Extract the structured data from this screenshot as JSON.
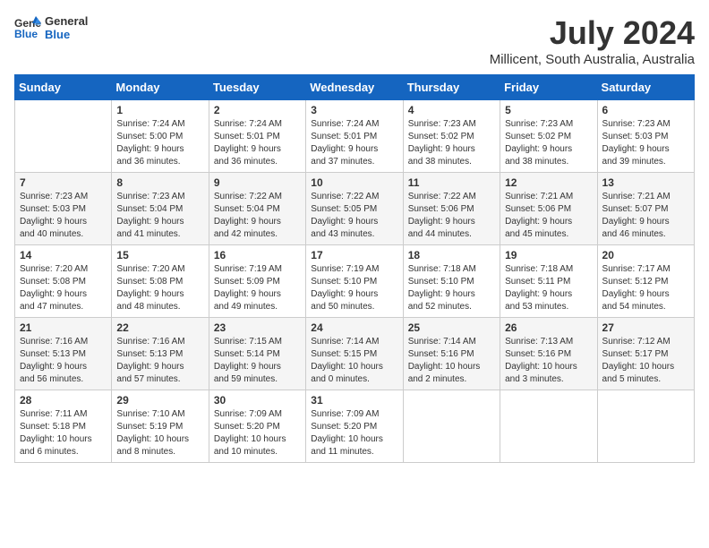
{
  "header": {
    "logo_line1": "General",
    "logo_line2": "Blue",
    "month_year": "July 2024",
    "location": "Millicent, South Australia, Australia"
  },
  "calendar": {
    "weekdays": [
      "Sunday",
      "Monday",
      "Tuesday",
      "Wednesday",
      "Thursday",
      "Friday",
      "Saturday"
    ],
    "weeks": [
      [
        {
          "day": "",
          "info": ""
        },
        {
          "day": "1",
          "info": "Sunrise: 7:24 AM\nSunset: 5:00 PM\nDaylight: 9 hours\nand 36 minutes."
        },
        {
          "day": "2",
          "info": "Sunrise: 7:24 AM\nSunset: 5:01 PM\nDaylight: 9 hours\nand 36 minutes."
        },
        {
          "day": "3",
          "info": "Sunrise: 7:24 AM\nSunset: 5:01 PM\nDaylight: 9 hours\nand 37 minutes."
        },
        {
          "day": "4",
          "info": "Sunrise: 7:23 AM\nSunset: 5:02 PM\nDaylight: 9 hours\nand 38 minutes."
        },
        {
          "day": "5",
          "info": "Sunrise: 7:23 AM\nSunset: 5:02 PM\nDaylight: 9 hours\nand 38 minutes."
        },
        {
          "day": "6",
          "info": "Sunrise: 7:23 AM\nSunset: 5:03 PM\nDaylight: 9 hours\nand 39 minutes."
        }
      ],
      [
        {
          "day": "7",
          "info": "Sunrise: 7:23 AM\nSunset: 5:03 PM\nDaylight: 9 hours\nand 40 minutes."
        },
        {
          "day": "8",
          "info": "Sunrise: 7:23 AM\nSunset: 5:04 PM\nDaylight: 9 hours\nand 41 minutes."
        },
        {
          "day": "9",
          "info": "Sunrise: 7:22 AM\nSunset: 5:04 PM\nDaylight: 9 hours\nand 42 minutes."
        },
        {
          "day": "10",
          "info": "Sunrise: 7:22 AM\nSunset: 5:05 PM\nDaylight: 9 hours\nand 43 minutes."
        },
        {
          "day": "11",
          "info": "Sunrise: 7:22 AM\nSunset: 5:06 PM\nDaylight: 9 hours\nand 44 minutes."
        },
        {
          "day": "12",
          "info": "Sunrise: 7:21 AM\nSunset: 5:06 PM\nDaylight: 9 hours\nand 45 minutes."
        },
        {
          "day": "13",
          "info": "Sunrise: 7:21 AM\nSunset: 5:07 PM\nDaylight: 9 hours\nand 46 minutes."
        }
      ],
      [
        {
          "day": "14",
          "info": "Sunrise: 7:20 AM\nSunset: 5:08 PM\nDaylight: 9 hours\nand 47 minutes."
        },
        {
          "day": "15",
          "info": "Sunrise: 7:20 AM\nSunset: 5:08 PM\nDaylight: 9 hours\nand 48 minutes."
        },
        {
          "day": "16",
          "info": "Sunrise: 7:19 AM\nSunset: 5:09 PM\nDaylight: 9 hours\nand 49 minutes."
        },
        {
          "day": "17",
          "info": "Sunrise: 7:19 AM\nSunset: 5:10 PM\nDaylight: 9 hours\nand 50 minutes."
        },
        {
          "day": "18",
          "info": "Sunrise: 7:18 AM\nSunset: 5:10 PM\nDaylight: 9 hours\nand 52 minutes."
        },
        {
          "day": "19",
          "info": "Sunrise: 7:18 AM\nSunset: 5:11 PM\nDaylight: 9 hours\nand 53 minutes."
        },
        {
          "day": "20",
          "info": "Sunrise: 7:17 AM\nSunset: 5:12 PM\nDaylight: 9 hours\nand 54 minutes."
        }
      ],
      [
        {
          "day": "21",
          "info": "Sunrise: 7:16 AM\nSunset: 5:13 PM\nDaylight: 9 hours\nand 56 minutes."
        },
        {
          "day": "22",
          "info": "Sunrise: 7:16 AM\nSunset: 5:13 PM\nDaylight: 9 hours\nand 57 minutes."
        },
        {
          "day": "23",
          "info": "Sunrise: 7:15 AM\nSunset: 5:14 PM\nDaylight: 9 hours\nand 59 minutes."
        },
        {
          "day": "24",
          "info": "Sunrise: 7:14 AM\nSunset: 5:15 PM\nDaylight: 10 hours\nand 0 minutes."
        },
        {
          "day": "25",
          "info": "Sunrise: 7:14 AM\nSunset: 5:16 PM\nDaylight: 10 hours\nand 2 minutes."
        },
        {
          "day": "26",
          "info": "Sunrise: 7:13 AM\nSunset: 5:16 PM\nDaylight: 10 hours\nand 3 minutes."
        },
        {
          "day": "27",
          "info": "Sunrise: 7:12 AM\nSunset: 5:17 PM\nDaylight: 10 hours\nand 5 minutes."
        }
      ],
      [
        {
          "day": "28",
          "info": "Sunrise: 7:11 AM\nSunset: 5:18 PM\nDaylight: 10 hours\nand 6 minutes."
        },
        {
          "day": "29",
          "info": "Sunrise: 7:10 AM\nSunset: 5:19 PM\nDaylight: 10 hours\nand 8 minutes."
        },
        {
          "day": "30",
          "info": "Sunrise: 7:09 AM\nSunset: 5:20 PM\nDaylight: 10 hours\nand 10 minutes."
        },
        {
          "day": "31",
          "info": "Sunrise: 7:09 AM\nSunset: 5:20 PM\nDaylight: 10 hours\nand 11 minutes."
        },
        {
          "day": "",
          "info": ""
        },
        {
          "day": "",
          "info": ""
        },
        {
          "day": "",
          "info": ""
        }
      ]
    ]
  }
}
